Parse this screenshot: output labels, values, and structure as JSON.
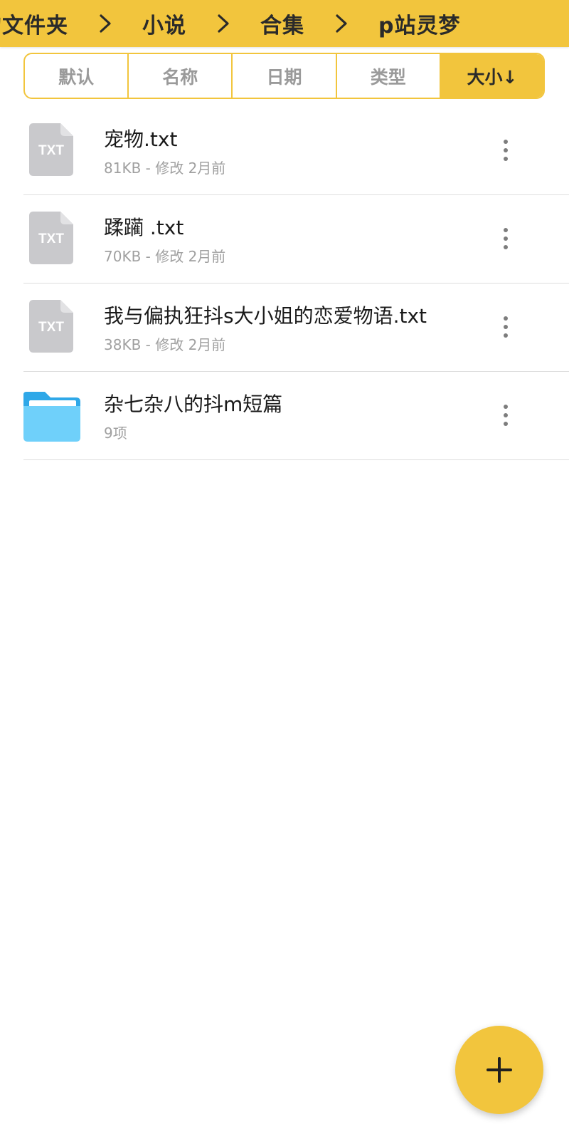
{
  "breadcrumb": {
    "items": [
      "的文件夹",
      "小说",
      "合集",
      "p站灵梦"
    ]
  },
  "sort_tabs": [
    {
      "label": "默认",
      "active": false
    },
    {
      "label": "名称",
      "active": false
    },
    {
      "label": "日期",
      "active": false
    },
    {
      "label": "类型",
      "active": false
    },
    {
      "label": "大小↓",
      "active": true
    }
  ],
  "files": [
    {
      "icon": "txt-file-icon",
      "icon_text": "TXT",
      "name": "宠物.txt",
      "meta": "81KB - 修改 2月前"
    },
    {
      "icon": "txt-file-icon",
      "icon_text": "TXT",
      "name": "蹂躏 .txt",
      "meta": "70KB - 修改 2月前"
    },
    {
      "icon": "txt-file-icon",
      "icon_text": "TXT",
      "name": "我与偏执狂抖s大小姐的恋爱物语.txt",
      "meta": "38KB - 修改 2月前"
    },
    {
      "icon": "folder-icon",
      "name": "杂七杂八的抖m短篇",
      "meta": "9项"
    }
  ],
  "colors": {
    "accent": "#F2C53D",
    "file_icon_gray": "#C9C9CC",
    "folder_blue": "#6FD0FA",
    "folder_blue_dark": "#2FA8E8"
  },
  "fab": {
    "icon": "plus-icon"
  }
}
